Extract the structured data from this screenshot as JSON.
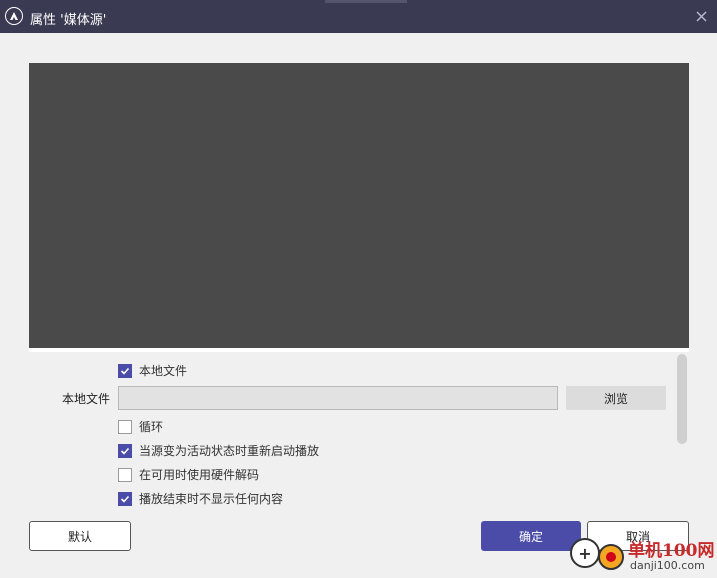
{
  "window": {
    "title": "属性 '媒体源'",
    "titlebar_color": "#3a3a52",
    "logo_icon": "obs-logo-icon",
    "close_icon": "close-icon"
  },
  "preview": {
    "background": "#4a4a4a"
  },
  "options": {
    "local_file_checkbox": {
      "label": "本地文件",
      "checked": true
    },
    "local_file_field": {
      "label": "本地文件",
      "value": ""
    },
    "browse_label": "浏览",
    "loop": {
      "label": "循环",
      "checked": false
    },
    "restart_on_activate": {
      "label": "当源变为活动状态时重新启动播放",
      "checked": true
    },
    "hw_decode": {
      "label": "在可用时使用硬件解码",
      "checked": false
    },
    "hide_on_end": {
      "label": "播放结束时不显示任何内容",
      "checked": true
    }
  },
  "buttons": {
    "defaults": "默认",
    "ok": "确定",
    "cancel": "取消",
    "accent": "#4b4ba8"
  },
  "watermark": {
    "name": "单机100网",
    "url": "danji100.com"
  }
}
